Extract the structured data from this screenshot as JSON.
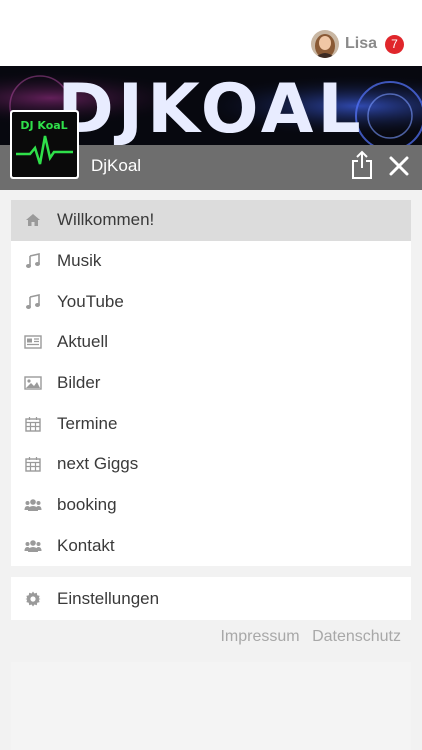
{
  "user": {
    "name": "Lisa",
    "notifications": "7"
  },
  "banner": {
    "text": "DJKOAL"
  },
  "logo": {
    "text": "DJ KoaL"
  },
  "header": {
    "title": "DjKoal"
  },
  "menu": [
    {
      "label": "Willkommen!",
      "icon": "home-icon",
      "active": true
    },
    {
      "label": "Musik",
      "icon": "music-note-icon",
      "active": false
    },
    {
      "label": "YouTube",
      "icon": "music-note-icon",
      "active": false
    },
    {
      "label": "Aktuell",
      "icon": "newspaper-icon",
      "active": false
    },
    {
      "label": "Bilder",
      "icon": "image-icon",
      "active": false
    },
    {
      "label": "Termine",
      "icon": "calendar-icon",
      "active": false
    },
    {
      "label": "next Giggs",
      "icon": "calendar-icon",
      "active": false
    },
    {
      "label": "booking",
      "icon": "users-icon",
      "active": false
    },
    {
      "label": "Kontakt",
      "icon": "users-icon",
      "active": false
    }
  ],
  "settings": {
    "label": "Einstellungen",
    "icon": "gear-icon"
  },
  "footer": {
    "impressum": "Impressum",
    "datenschutz": "Datenschutz"
  },
  "colors": {
    "header_gray": "#6e6e6e",
    "badge_red": "#e0262b",
    "logo_green": "#2fe04a",
    "active_row": "#dcdcdc"
  }
}
